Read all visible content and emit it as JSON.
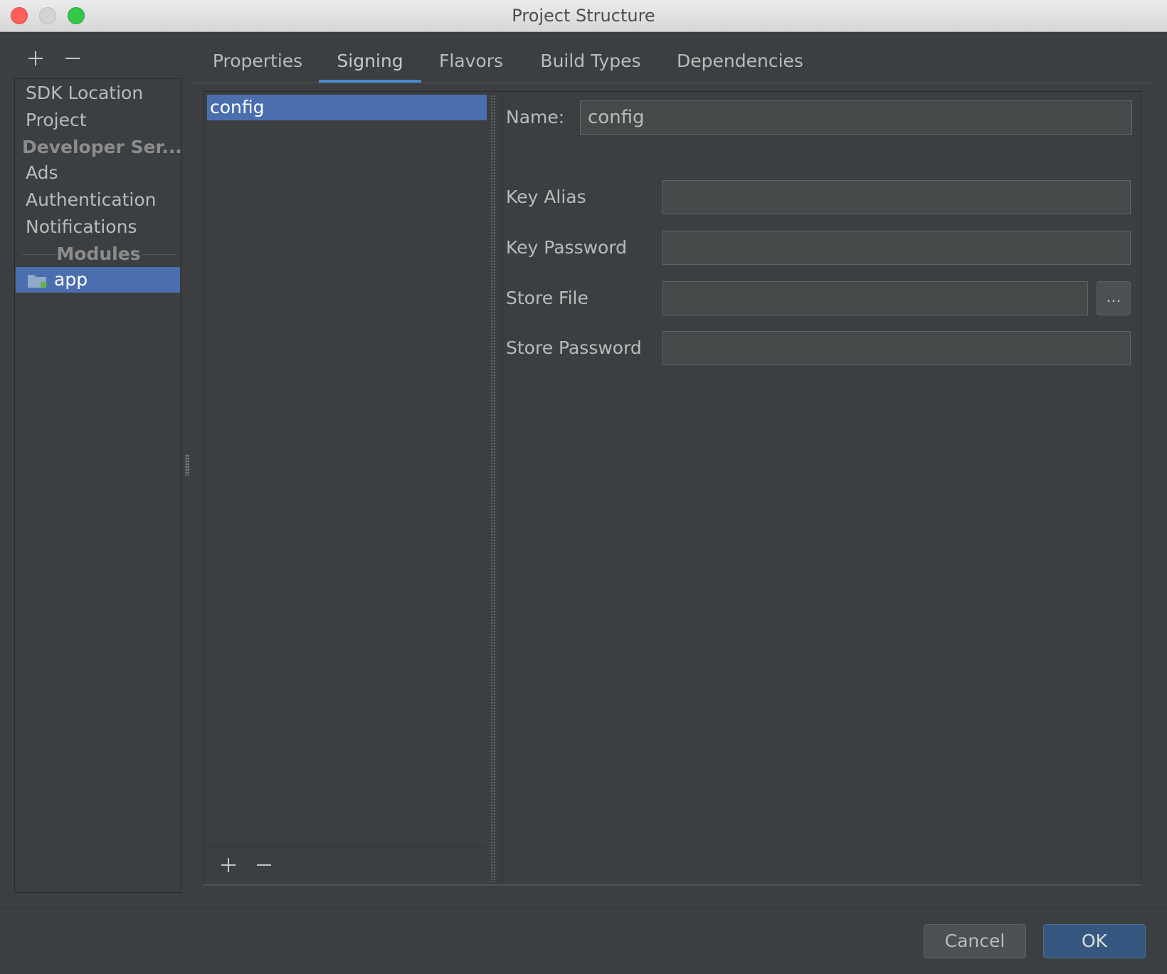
{
  "window": {
    "title": "Project Structure"
  },
  "sidebar": {
    "add_label": "+",
    "remove_label": "−",
    "items": [
      {
        "label": "SDK Location"
      },
      {
        "label": "Project"
      },
      {
        "label": "Developer Ser..."
      },
      {
        "label": "Ads"
      },
      {
        "label": "Authentication"
      },
      {
        "label": "Notifications"
      }
    ],
    "modules_header": "Modules",
    "modules": [
      {
        "label": "app",
        "icon": "module-folder-icon"
      }
    ]
  },
  "tabs": [
    {
      "label": "Properties"
    },
    {
      "label": "Signing",
      "selected": true
    },
    {
      "label": "Flavors"
    },
    {
      "label": "Build Types"
    },
    {
      "label": "Dependencies"
    }
  ],
  "signing": {
    "configs": [
      {
        "label": "config",
        "selected": true
      }
    ],
    "name_label": "Name:",
    "name_value": "config",
    "key_alias_label": "Key Alias",
    "key_alias_value": "",
    "key_password_label": "Key Password",
    "key_password_value": "",
    "store_file_label": "Store File",
    "store_file_value": "",
    "browse_label": "...",
    "store_password_label": "Store Password",
    "store_password_value": ""
  },
  "footer": {
    "cancel_label": "Cancel",
    "ok_label": "OK"
  },
  "colors": {
    "selection": "#4b6eaf",
    "accent": "#4a88c7",
    "background": "#3c3f41"
  }
}
